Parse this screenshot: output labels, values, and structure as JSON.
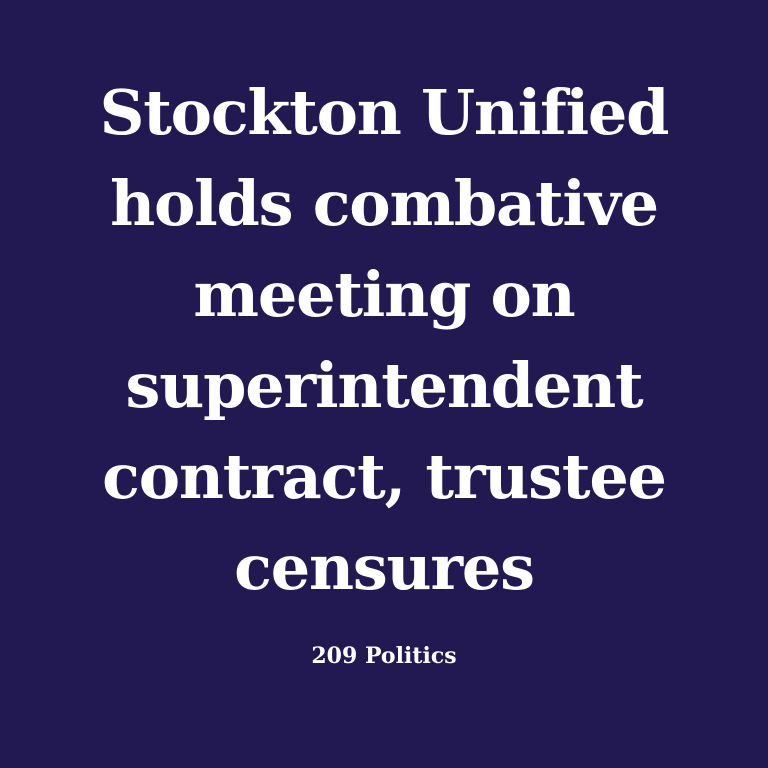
{
  "headline": {
    "lines": [
      "Stockton Unified",
      "holds combative",
      "meeting on",
      "superintendent",
      "contract, trustee",
      "censures"
    ]
  },
  "source": "209 Politics",
  "colors": {
    "background": "#221852",
    "text": "#ffffff"
  }
}
